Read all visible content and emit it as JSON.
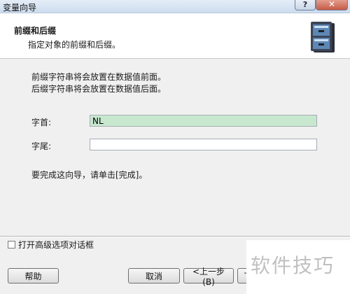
{
  "window": {
    "title": "变量向导",
    "help_glyph": "?",
    "close_glyph": "✕"
  },
  "header": {
    "title": "前缀和后缀",
    "subtitle": "指定对象的前缀和后缀。"
  },
  "body": {
    "line1": "前缀字符串将会放置在数据值前面。",
    "line2": "后缀字符串将会放置在数据值后面。",
    "finish_hint": "要完成这向导，请单击[完成]。"
  },
  "fields": {
    "prefix_label": "字首:",
    "prefix_value": "NL",
    "suffix_label": "字尾:",
    "suffix_value": ""
  },
  "options": {
    "advanced_label": "打开高级选项对话框",
    "advanced_checked": false
  },
  "buttons": {
    "help": "帮助",
    "cancel": "取消",
    "back": "<上一步(B)",
    "next_partial": "下"
  },
  "watermark": "软件技巧",
  "colors": {
    "prefix_bg": "#c7e8cf",
    "close_btn": "#c75a45"
  }
}
